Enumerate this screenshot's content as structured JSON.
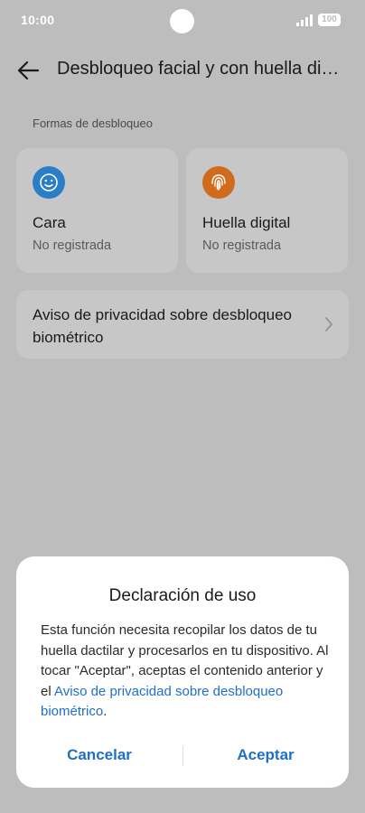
{
  "status_bar": {
    "time": "10:00",
    "battery": "100"
  },
  "header": {
    "title": "Desbloqueo facial y con huella digital"
  },
  "section": {
    "label": "Formas de desbloqueo"
  },
  "unlock_methods": [
    {
      "title": "Cara",
      "status": "No registrada",
      "icon": "face-icon",
      "color": "#2a7ec8"
    },
    {
      "title": "Huella digital",
      "status": "No registrada",
      "icon": "fingerprint-icon",
      "color": "#d06a1c"
    }
  ],
  "privacy": {
    "label": "Aviso de privacidad sobre desbloqueo biométrico"
  },
  "dialog": {
    "title": "Declaración de uso",
    "body": "Esta función necesita recopilar los datos de tu huella dactilar y procesarlos en tu dispositivo. Al tocar \"Aceptar\", aceptas el contenido anterior y el ",
    "link": "Aviso de privacidad sobre desbloqueo biométrico",
    "body_end": ".",
    "cancel": "Cancelar",
    "accept": "Aceptar"
  },
  "colors": {
    "accent": "#1f6fc9",
    "scrim": "#bdbdbd"
  }
}
